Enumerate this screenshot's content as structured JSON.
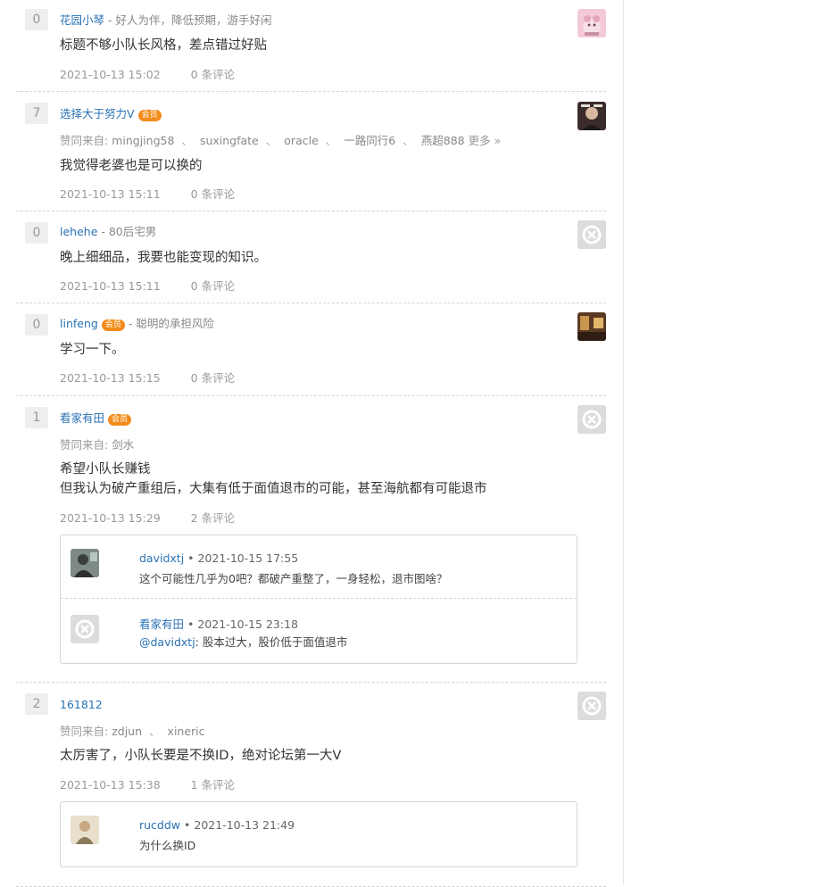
{
  "answers": [
    {
      "votes": "0",
      "name": "花园小琴",
      "badge": "",
      "signature": "好人为伴，降低预期，游手好闲",
      "agree_label": "",
      "agree_users": [],
      "more": "",
      "content": [
        "标题不够小队长风格，差点错过好贴"
      ],
      "time": "2021-10-13 15:02",
      "comment_count": "0 条评论",
      "comments": []
    },
    {
      "votes": "7",
      "name": "选择大于努力V",
      "badge": "会员",
      "signature": "",
      "agree_label": "赞同来自:",
      "agree_users": [
        "mingjing58",
        "suxingfate",
        "oracle",
        "一路同行6",
        "燕超888"
      ],
      "more": "更多 »",
      "content": [
        "我觉得老婆也是可以换的"
      ],
      "time": "2021-10-13 15:11",
      "comment_count": "0 条评论",
      "comments": []
    },
    {
      "votes": "0",
      "name": "lehehe",
      "badge": "",
      "signature": "80后宅男",
      "agree_label": "",
      "agree_users": [],
      "more": "",
      "content": [
        "晚上细细品，我要也能变现的知识。"
      ],
      "time": "2021-10-13 15:11",
      "comment_count": "0 条评论",
      "comments": []
    },
    {
      "votes": "0",
      "name": "linfeng",
      "badge": "会员",
      "signature": "聪明的承担风险",
      "agree_label": "",
      "agree_users": [],
      "more": "",
      "content": [
        "学习一下。"
      ],
      "time": "2021-10-13 15:15",
      "comment_count": "0 条评论",
      "comments": []
    },
    {
      "votes": "1",
      "name": "看家有田",
      "badge": "会员",
      "signature": "",
      "agree_label": "赞同来自:",
      "agree_users": [
        "剑水"
      ],
      "more": "",
      "content": [
        "希望小队长赚钱",
        "但我认为破产重组后，大集有低于面值退市的可能，甚至海航都有可能退市"
      ],
      "time": "2021-10-13 15:29",
      "comment_count": "2 条评论",
      "comments": [
        {
          "name": "davidxtj",
          "time": "2021-10-15 17:55",
          "mention": "",
          "text": "这个可能性几乎为0吧？都破产重整了，一身轻松，退市图啥？"
        },
        {
          "name": "看家有田",
          "time": "2021-10-15 23:18",
          "mention": "@davidxtj",
          "text": ": 股本过大，股价低于面值退市"
        }
      ]
    },
    {
      "votes": "2",
      "name": "161812",
      "badge": "",
      "signature": "",
      "agree_label": "赞同来自:",
      "agree_users": [
        "zdjun",
        "xineric"
      ],
      "more": "",
      "content": [
        "太厉害了，小队长要是不换ID，绝对论坛第一大V"
      ],
      "time": "2021-10-13 15:38",
      "comment_count": "1 条评论",
      "comments": [
        {
          "name": "rucddw",
          "time": "2021-10-13 21:49",
          "mention": "",
          "text": "为什么换ID"
        }
      ]
    }
  ],
  "ui": {
    "bullet": "•",
    "sig_sep": " - ",
    "agree_sep": "、"
  },
  "colors": {
    "link": "#2a72b5",
    "badge": "#f28c1b",
    "vote_bg": "#eeeeee",
    "meta": "#999999"
  }
}
